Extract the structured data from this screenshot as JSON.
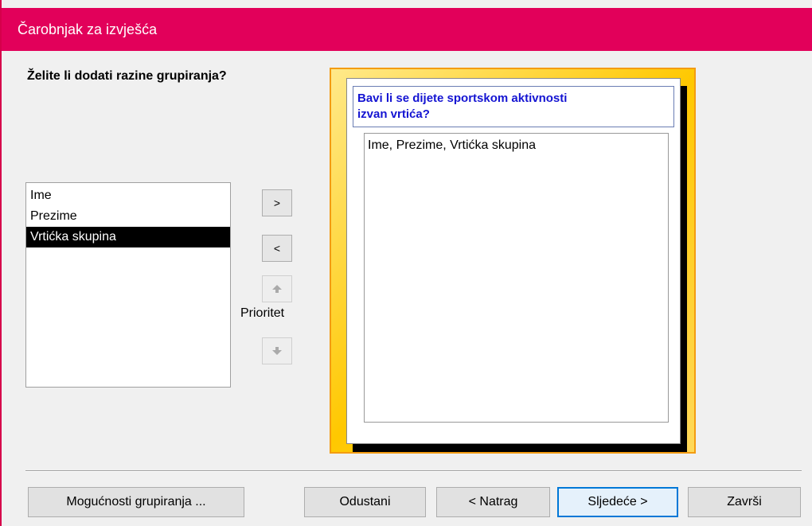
{
  "window": {
    "title": "Čarobnjak za izvješća"
  },
  "question": "Želite li dodati razine grupiranja?",
  "fields": [
    {
      "label": "Ime",
      "selected": false
    },
    {
      "label": "Prezime",
      "selected": false
    },
    {
      "label": "Vrtićka skupina",
      "selected": true
    }
  ],
  "controls": {
    "add_label": ">",
    "remove_label": "<",
    "up_icon": "up-arrow-icon",
    "down_icon": "down-arrow-icon",
    "priority_label": "Prioritet"
  },
  "preview": {
    "group_header_line1": "Bavi li se dijete sportskom aktivnosti",
    "group_header_line2": "izvan vrtića?",
    "detail_fields": "Ime, Prezime, Vrtićka skupina"
  },
  "buttons": {
    "grouping_options": "Mogućnosti grupiranja ...",
    "cancel": "Odustani",
    "back": "< Natrag",
    "next": "Sljedeće >",
    "finish": "Završi"
  },
  "colors": {
    "titlebar": "#e2005a",
    "preview_frame": "#f39c12",
    "group_header_text": "#1414d2",
    "default_button_border": "#0078d7"
  }
}
